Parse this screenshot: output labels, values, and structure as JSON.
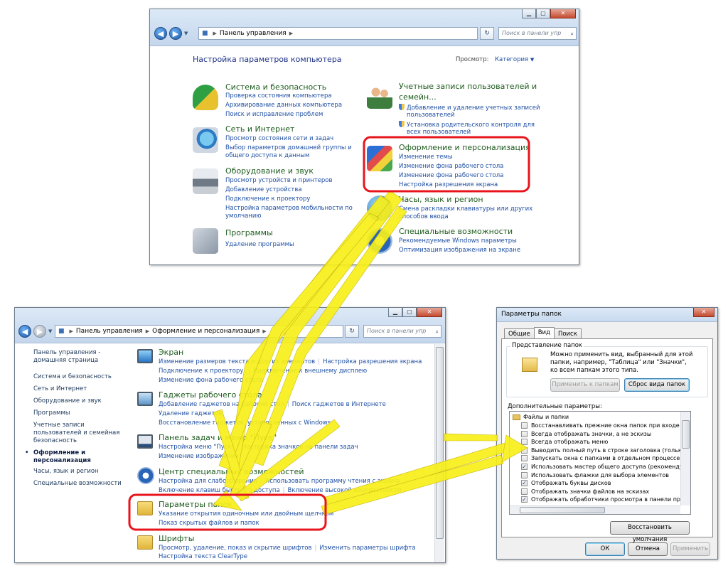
{
  "cp_window": {
    "address": "Панель управления",
    "search_placeholder": "Поиск в панели упр",
    "page_title": "Настройка параметров компьютера",
    "view_label": "Просмотр:",
    "view_value": "Категория",
    "categories": [
      {
        "title": "Система и безопасность",
        "icon": "shield-icon",
        "links": [
          "Проверка состояния компьютера",
          "Архивирование данных компьютера",
          "Поиск и исправление проблем"
        ]
      },
      {
        "title": "Сеть и Интернет",
        "icon": "network-icon",
        "links": [
          "Просмотр состояния сети и задач",
          "Выбор параметров домашней группы и",
          "общего доступа к данным"
        ]
      },
      {
        "title": "Оборудование и звук",
        "icon": "printer-icon",
        "links": [
          "Просмотр устройств и принтеров",
          "Добавление устройства",
          "Подключение к проектору",
          "Настройка параметров мобильности по",
          "умолчанию"
        ]
      },
      {
        "title": "Программы",
        "icon": "programs-icon",
        "links": [
          "Удаление программы"
        ]
      }
    ],
    "users": {
      "title_line1": "Учетные записи пользователей и",
      "title_line2": "семейн...",
      "links": [
        "Добавление и удаление учетных записей",
        "пользователей",
        "Установка родительского контроля для",
        "всех пользователей"
      ]
    },
    "appearance": {
      "title": "Оформление и персонализация",
      "links": [
        "Изменение темы",
        "Изменение фона рабочего стола",
        "Изменение фона рабочего стола",
        "Настройка разрешения экрана"
      ]
    },
    "clock": {
      "title": "Часы, язык и регион",
      "links": [
        "Смена раскладки клавиатуры или других",
        "способов ввода"
      ]
    },
    "access": {
      "title": "Специальные возможности",
      "links": [
        "Рекомендуемые Windows параметры",
        "Оптимизация изображения на экране"
      ]
    }
  },
  "ap_window": {
    "crumb1": "Панель управления",
    "crumb2": "Оформление и персонализация",
    "search_placeholder": "Поиск в панели упр",
    "sidebar": [
      "Панель управления -",
      "домашняя страница",
      "Система и безопасность",
      "Сеть и Интернет",
      "Оборудование и звук",
      "Программы",
      "Учетные записи",
      "пользователей и семейная",
      "безопасность",
      "Оформление и",
      "персонализация",
      "Часы, язык и регион",
      "Специальные возможности"
    ],
    "sections": [
      {
        "title": "Экран",
        "rows": [
          [
            "Изменение размеров текста и других элементов",
            "Настройка разрешения экрана"
          ],
          [
            "Подключение к проектору.",
            "Подключение к внешнему дисплею"
          ],
          [
            "Изменение фона рабочего стола"
          ]
        ]
      },
      {
        "title": "Гаджеты рабочего стола",
        "rows": [
          [
            "Добавление гаджетов на рабочий стол",
            "Поиск гаджетов в Интернете"
          ],
          [
            "Удаление гаджетов"
          ],
          [
            "Восстановление гаджетов, установленных с Windows"
          ]
        ]
      },
      {
        "title": "Панель задач и меню \"Пуск\"",
        "rows": [
          [
            "Настройка меню \"Пуск\"",
            "Настройка значков на панели задач"
          ],
          [
            "Изменение изображения"
          ]
        ]
      },
      {
        "title": "Центр специальных возможностей",
        "rows": [
          [
            "Настройка для слабого зрения",
            "Использовать программу чтения с экрана"
          ],
          [
            "Включение клавиш быстрого доступа",
            "Включение высокой контрастности"
          ]
        ]
      },
      {
        "title": "Параметры папок",
        "rows": [
          [
            "Указание открытия одиночным или двойным щелчком"
          ],
          [
            "Показ скрытых файлов и папок"
          ]
        ]
      },
      {
        "title": "Шрифты",
        "rows": [
          [
            "Просмотр, удаление, показ и скрытие шрифтов",
            "Изменить параметры шрифта"
          ],
          [
            "Настройка текста ClearType"
          ]
        ]
      }
    ]
  },
  "dialog": {
    "title": "Параметры папок",
    "tabs": [
      "Общие",
      "Вид",
      "Поиск"
    ],
    "group1_label": "Представление папок",
    "group1_text": [
      "Можно применить вид, выбранный для этой",
      "папки, например, \"Таблица\" или \"Значки\",",
      "ко всем папкам этого типа."
    ],
    "apply_button": "Применить к папкам",
    "reset_button": "Сброс вида папок",
    "advanced_label": "Дополнительные параметры:",
    "tree_root": "Файлы и папки",
    "options": [
      {
        "label": "Восстанавливать прежние окна папок при входе в си",
        "checked": false
      },
      {
        "label": "Всегда отображать значки, а не эскизы",
        "checked": false
      },
      {
        "label": "Всегда отображать меню",
        "checked": false
      },
      {
        "label": "Выводить полный путь в строке заголовка (только д",
        "checked": false
      },
      {
        "label": "Запускать окна с папками в отдельном процессе",
        "checked": false
      },
      {
        "label": "Использовать мастер общего доступа (рекомендует",
        "checked": true
      },
      {
        "label": "Использовать флажки для выбора элементов",
        "checked": false
      },
      {
        "label": "Отображать буквы дисков",
        "checked": true
      },
      {
        "label": "Отображать значки файлов на эскизах",
        "checked": false
      },
      {
        "label": "Отображать обработчики просмотра в панели просм",
        "checked": true
      }
    ],
    "restore_button": "Восстановить умолчания",
    "ok_button": "ОК",
    "cancel_button": "Отмена",
    "apply2_button": "Применить"
  },
  "colors": {
    "highlight": "#e8141c",
    "arrow": "#f7ef1a",
    "link": "#1e4fa3",
    "heading": "#1e5c1e"
  }
}
